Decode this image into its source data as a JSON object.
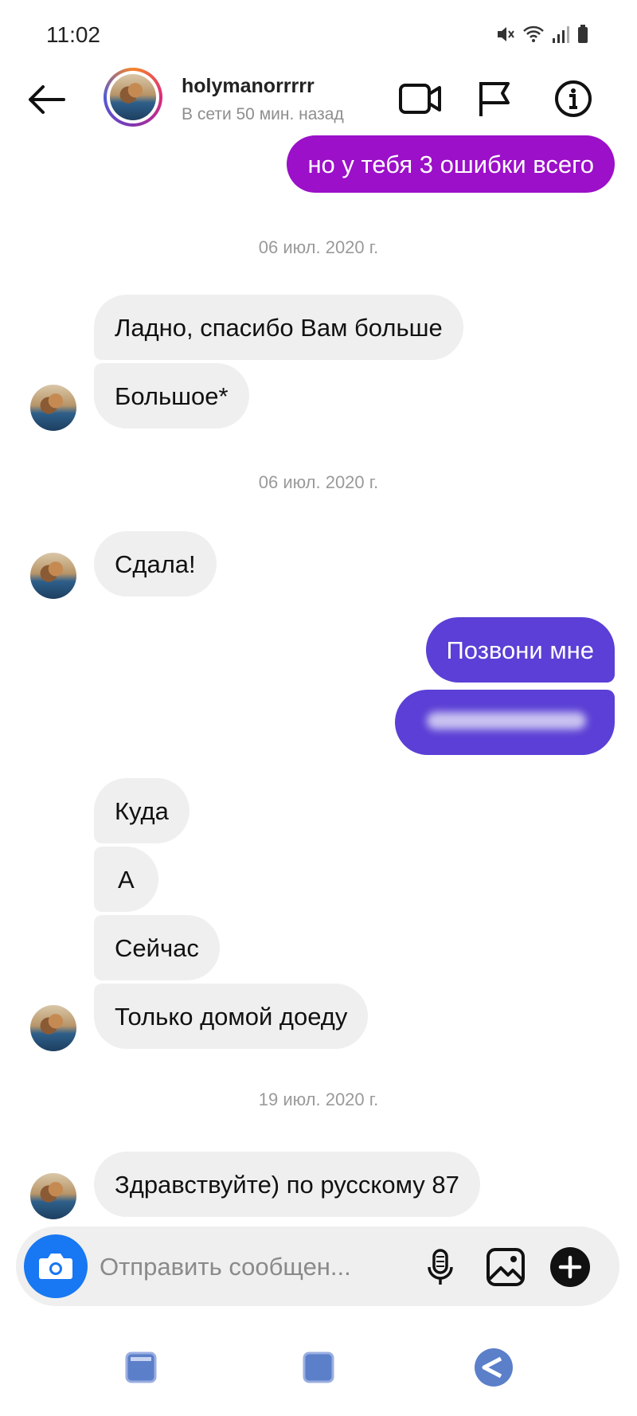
{
  "status_bar": {
    "time": "11:02"
  },
  "header": {
    "username": "holymanorrrrr",
    "presence": "В сети 50 мин. назад",
    "icons": [
      "back-arrow-icon",
      "video-call-icon",
      "flag-icon",
      "info-icon"
    ]
  },
  "thread": {
    "m0": "но у тебя 3 ошибки всего",
    "d1": "06 июл. 2020 г.",
    "m1": "Ладно, спасибо Вам больше",
    "m2": "Большое*",
    "d2": "06 июл. 2020 г.",
    "m3": "Сдала!",
    "m4": "Позвони мне",
    "m5": "",
    "m6": "Куда",
    "m7": "А",
    "m8": "Сейчас",
    "m9": "Только домой доеду",
    "d3": "19 июл. 2020 г.",
    "m10": "Здравствуйте) по русскому 87"
  },
  "composer": {
    "placeholder": "Отправить сообщен...",
    "icons": [
      "camera-icon",
      "microphone-icon",
      "gallery-icon",
      "plus-icon"
    ]
  },
  "colors": {
    "outgoing_purple": "#9b10c8",
    "outgoing_violet": "#5b3fd6",
    "incoming_gray": "#efefef",
    "camera_blue": "#1877f2"
  }
}
